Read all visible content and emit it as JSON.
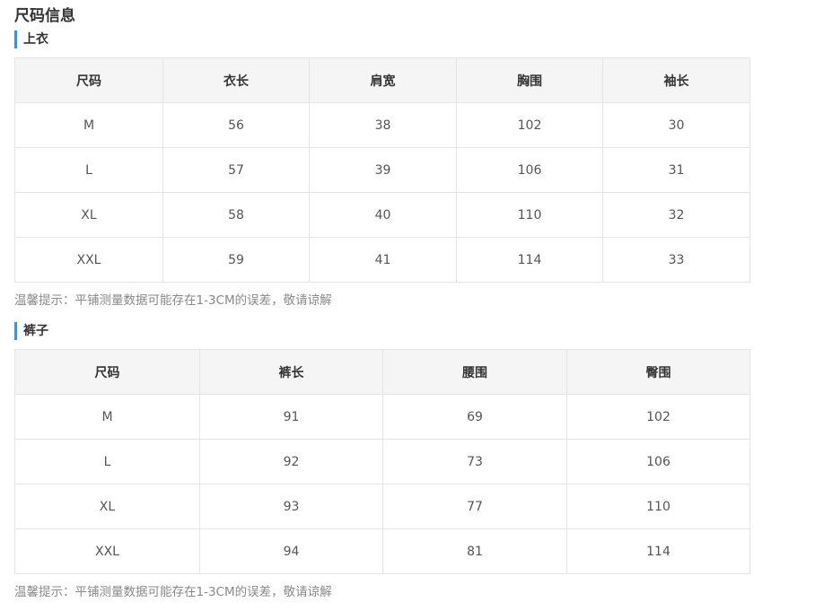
{
  "page_title": "尺码信息",
  "tops": {
    "heading": "上衣",
    "columns": [
      "尺码",
      "衣长",
      "肩宽",
      "胸围",
      "袖长"
    ],
    "rows": [
      [
        "M",
        "56",
        "38",
        "102",
        "30"
      ],
      [
        "L",
        "57",
        "39",
        "106",
        "31"
      ],
      [
        "XL",
        "58",
        "40",
        "110",
        "32"
      ],
      [
        "XXL",
        "59",
        "41",
        "114",
        "33"
      ]
    ],
    "note": "温馨提示：平铺测量数据可能存在1-3CM的误差，敬请谅解"
  },
  "pants": {
    "heading": "裤子",
    "columns": [
      "尺码",
      "裤长",
      "腰围",
      "臀围"
    ],
    "rows": [
      [
        "M",
        "91",
        "69",
        "102"
      ],
      [
        "L",
        "92",
        "73",
        "106"
      ],
      [
        "XL",
        "93",
        "77",
        "110"
      ],
      [
        "XXL",
        "94",
        "81",
        "114"
      ]
    ],
    "note": "温馨提示：平铺测量数据可能存在1-3CM的误差，敬请谅解"
  },
  "colors": {
    "accent": "#4a90c2",
    "header_bg": "#f5f5f5",
    "border": "#e4e4e4",
    "note_text": "#888888"
  }
}
